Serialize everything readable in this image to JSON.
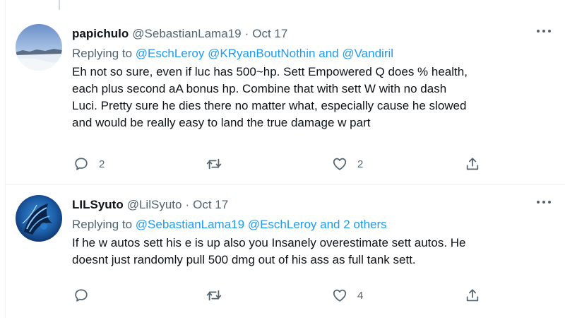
{
  "colors": {
    "link": "#1d9bf0",
    "muted": "#536471",
    "text": "#0f1419"
  },
  "tweets": [
    {
      "name": "papichulo",
      "handle": "@SebastianLama19",
      "separator": "·",
      "date": "Oct 17",
      "replying_prefix": "Replying to ",
      "mentions": [
        "@EschLeroy",
        "@KRyanBoutNothin",
        "and",
        "@Vandiril"
      ],
      "text_lines": [
        "Eh not so sure, even if luc has 500~hp. Sett Empowered Q does % health,",
        "each plus second aA bonus hp. Combine that with sett W with no dash",
        "Luci. Pretty sure he dies there no matter what, especially cause he slowed",
        "and would be really easy to land the true damage w part"
      ],
      "reply_count": "2",
      "retweet_count": "",
      "like_count": "2",
      "icons": [
        "reply-icon",
        "retweet-icon",
        "like-icon",
        "share-icon",
        "more-icon"
      ]
    },
    {
      "name": "LILSyuto",
      "handle": "@LilSyuto",
      "separator": "·",
      "date": "Oct 17",
      "replying_prefix": "Replying to ",
      "mentions": [
        "@SebastianLama19",
        "@EschLeroy",
        "and 2 others"
      ],
      "text_lines": [
        "If he w autos sett his e is up also you Insanely overestimate sett autos. He",
        "doesnt just randomly pull 500 dmg out of his ass as full tank sett."
      ],
      "reply_count": "",
      "retweet_count": "",
      "like_count": "4",
      "icons": [
        "reply-icon",
        "retweet-icon",
        "like-icon",
        "share-icon",
        "more-icon"
      ]
    }
  ]
}
